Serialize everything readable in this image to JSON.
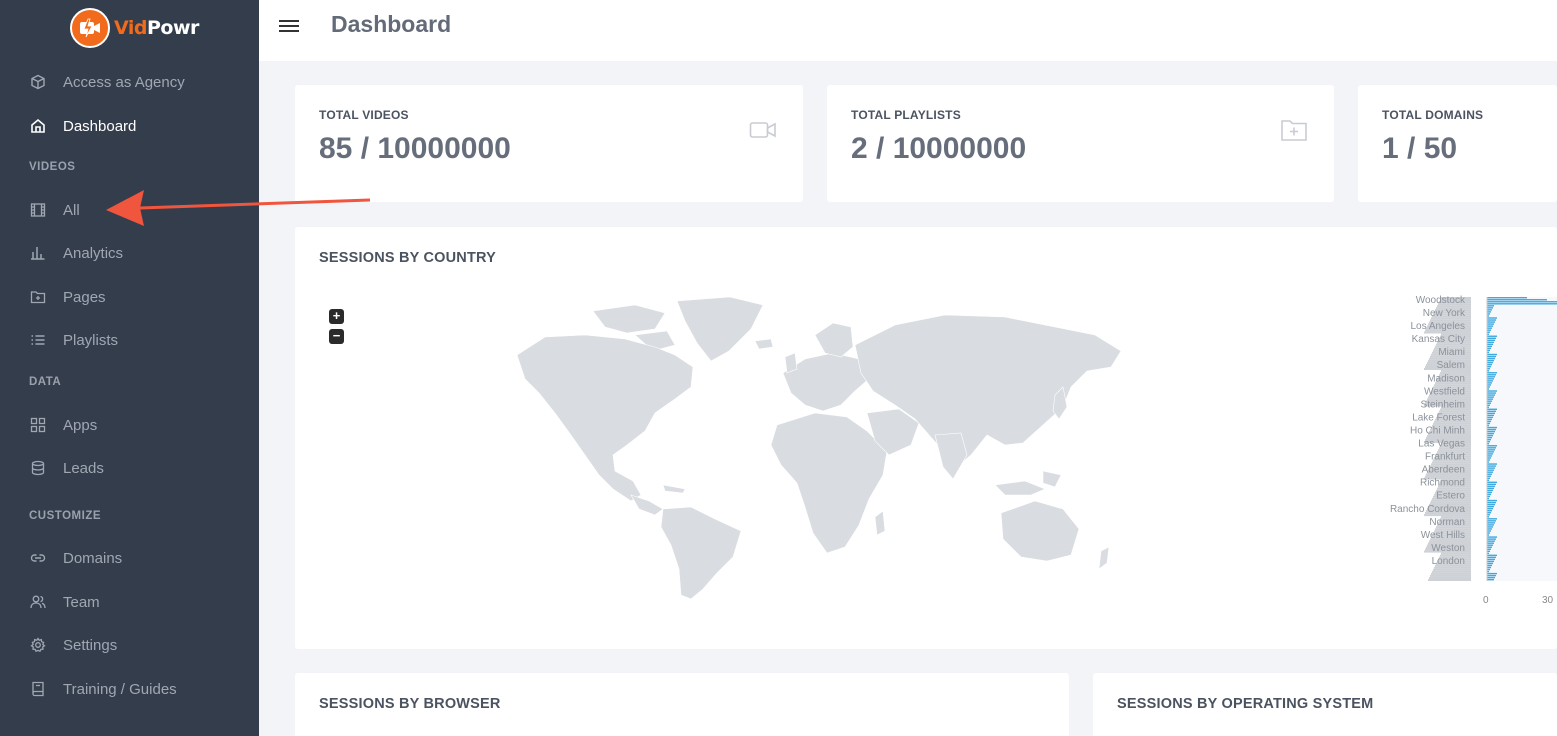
{
  "brand": {
    "name_white_prefix": "Vid",
    "name_rest": "Powr",
    "accent": "#f26a1b"
  },
  "sidebar": {
    "items_top": [
      {
        "label": "Access as Agency",
        "icon": "box-icon"
      },
      {
        "label": "Dashboard",
        "icon": "home-icon"
      }
    ],
    "sections": [
      {
        "label": "VIDEOS",
        "items": [
          {
            "label": "All",
            "icon": "film-icon"
          },
          {
            "label": "Analytics",
            "icon": "bar-chart-icon"
          },
          {
            "label": "Pages",
            "icon": "folder-plus-icon"
          },
          {
            "label": "Playlists",
            "icon": "list-icon"
          }
        ]
      },
      {
        "label": "DATA",
        "items": [
          {
            "label": "Apps",
            "icon": "grid-icon"
          },
          {
            "label": "Leads",
            "icon": "database-icon"
          }
        ]
      },
      {
        "label": "CUSTOMIZE",
        "items": [
          {
            "label": "Domains",
            "icon": "link-icon"
          },
          {
            "label": "Team",
            "icon": "users-icon"
          },
          {
            "label": "Settings",
            "icon": "gear-icon"
          },
          {
            "label": "Training / Guides",
            "icon": "book-icon"
          }
        ]
      }
    ]
  },
  "header": {
    "title": "Dashboard"
  },
  "stats": [
    {
      "label": "TOTAL VIDEOS",
      "value": "85 / 10000000",
      "icon": "video-camera-icon"
    },
    {
      "label": "TOTAL PLAYLISTS",
      "value": "2 / 10000000",
      "icon": "folder-plus-icon"
    },
    {
      "label": "TOTAL DOMAINS",
      "value": "1 / 50",
      "icon": "globe-icon"
    }
  ],
  "panels": {
    "country": "SESSIONS BY COUNTRY",
    "browser": "SESSIONS BY BROWSER",
    "os": "SESSIONS BY OPERATING SYSTEM"
  },
  "map": {
    "zoom_in": "+",
    "zoom_out": "−"
  },
  "city_chart": {
    "labels": [
      "Woodstock",
      "New York",
      "Los Angeles",
      "Kansas City",
      "Miami",
      "Salem",
      "Madison",
      "Westfield",
      "Steinheim",
      "Lake Forest",
      "Ho Chi Minh",
      "Las Vegas",
      "Frankfurt",
      "Aberdeen",
      "Richmond",
      "Estero",
      "Rancho Cordova",
      "Norman",
      "West Hills",
      "Weston",
      "London"
    ],
    "x_ticks": [
      "0",
      "30"
    ]
  },
  "colors": {
    "sidebar_bg": "#343d4b",
    "page_bg": "#f3f4f7",
    "map_land": "#d9dce0",
    "bar_blue": "#3fa9e0",
    "annotation_arrow": "#f0553d"
  }
}
